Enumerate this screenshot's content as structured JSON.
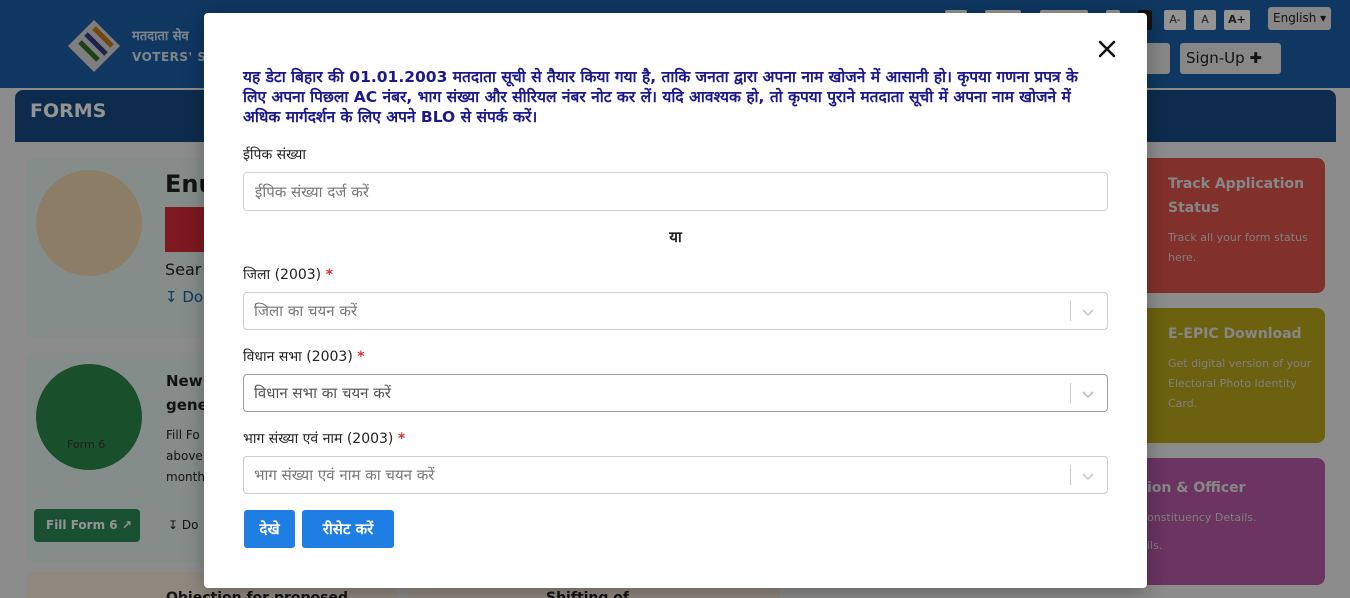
{
  "background": {
    "brand_line1": "मतदाता सेव",
    "brand_line2": "VOTERS' S",
    "font_small": "A-",
    "font_normal": "A",
    "font_large": "A+",
    "language": "English",
    "signup_label": "Sign-Up",
    "forms_heading": "FORMS",
    "card1_title": "Enu",
    "card1_search": "Sear",
    "card1_download": "Do",
    "card2_title_1": "New",
    "card2_title_2": "gene",
    "card2_desc_1": "Fill Fo",
    "card2_desc_2": "above",
    "card2_desc_3": "month",
    "form6_label": "Form 6",
    "fill_form_label": "Fill Form 6",
    "download_label": "Do",
    "bottom_card_left": "Objection for proposed",
    "bottom_card_right": "Shifting of",
    "track_title_1": "Track Application",
    "track_title_2": "Status",
    "track_desc_1": "Track all your form status",
    "track_desc_2": "here.",
    "epic_title": "E-EPIC Download",
    "epic_desc_1": "Get digital version of your",
    "epic_desc_2": "Electoral Photo Identity",
    "epic_desc_3": "Card.",
    "officer_title": "ion & Officer",
    "officer_desc_1": "onstituency Details.",
    "officer_desc_2": "ils."
  },
  "modal": {
    "notice": "यह डेटा बिहार की 01.01.2003 मतदाता सूची से तैयार किया गया है, ताकि जनता द्वारा अपना नाम खोजने में आसानी हो। कृपया गणना प्रपत्र के लिए अपना पिछला AC नंबर, भाग संख्या और सीरियल नंबर नोट कर लें। यदि आवश्यक हो, तो कृपया पुराने मतदाता सूची में अपना नाम खोजने में अधिक मार्गदर्शन के लिए अपने BLO से संपर्क करें।",
    "epic_label": "ईपिक संख्या",
    "epic_placeholder": "ईपिक संख्या दर्ज करें",
    "or_label": "या",
    "district_label": "जिला (2003)",
    "district_placeholder": "जिला का चयन करें",
    "assembly_label": "विधान सभा (2003)",
    "assembly_placeholder": "विधान सभा का चयन करें",
    "part_label": "भाग संख्या एवं नाम (2003)",
    "part_placeholder": "भाग संख्या एवं नाम का चयन करें",
    "required_mark": "*",
    "view_button": "देखे",
    "reset_button": "रीसेट करें"
  },
  "colors": {
    "accent": "#1e7ee4",
    "notice_text": "#1c1a8a",
    "required": "#d9322d"
  }
}
